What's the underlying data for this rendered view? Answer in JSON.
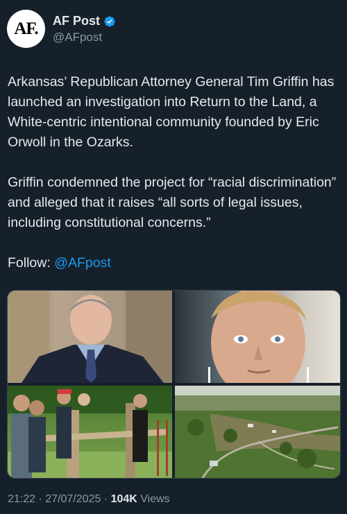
{
  "post": {
    "author_name": "AF Post",
    "author_handle": "@AFpost",
    "avatar_text": "AF.",
    "paragraph1": "Arkansas’ Republican Attorney General Tim Griffin has launched an investigation into Return to the Land, a White-centric intentional community founded by Eric Orwoll in the Ozarks.",
    "paragraph2": "Griffin condemned the project for “racial discrimination” and alleged that it raises “all sorts of legal issues, including constitutional concerns.”",
    "follow_label": "Follow:",
    "follow_handle": "@AFpost",
    "timestamp": "21:22 · 27/07/2025 · ",
    "views_count": "104K",
    "views_label": "Views"
  },
  "colors": {
    "background": "#15202b",
    "link": "#1d9bf0",
    "verified": "#1d9bf0",
    "secondary_text": "#8b98a5"
  },
  "media": [
    {
      "name": "photo-attorney-general"
    },
    {
      "name": "photo-eric-orwoll"
    },
    {
      "name": "photo-men-building-fence"
    },
    {
      "name": "photo-aerial-ozarks-land"
    }
  ]
}
